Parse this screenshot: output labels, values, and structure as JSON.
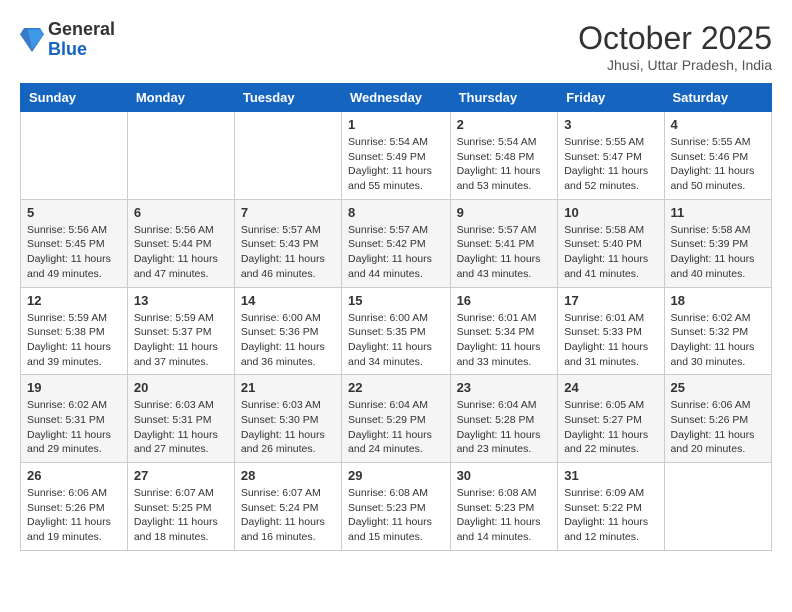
{
  "logo": {
    "general": "General",
    "blue": "Blue"
  },
  "header": {
    "month": "October 2025",
    "location": "Jhusi, Uttar Pradesh, India"
  },
  "weekdays": [
    "Sunday",
    "Monday",
    "Tuesday",
    "Wednesday",
    "Thursday",
    "Friday",
    "Saturday"
  ],
  "weeks": [
    [
      null,
      null,
      null,
      {
        "day": 1,
        "sunrise": "5:54 AM",
        "sunset": "5:49 PM",
        "daylight": "11 hours and 55 minutes."
      },
      {
        "day": 2,
        "sunrise": "5:54 AM",
        "sunset": "5:48 PM",
        "daylight": "11 hours and 53 minutes."
      },
      {
        "day": 3,
        "sunrise": "5:55 AM",
        "sunset": "5:47 PM",
        "daylight": "11 hours and 52 minutes."
      },
      {
        "day": 4,
        "sunrise": "5:55 AM",
        "sunset": "5:46 PM",
        "daylight": "11 hours and 50 minutes."
      }
    ],
    [
      {
        "day": 5,
        "sunrise": "5:56 AM",
        "sunset": "5:45 PM",
        "daylight": "11 hours and 49 minutes."
      },
      {
        "day": 6,
        "sunrise": "5:56 AM",
        "sunset": "5:44 PM",
        "daylight": "11 hours and 47 minutes."
      },
      {
        "day": 7,
        "sunrise": "5:57 AM",
        "sunset": "5:43 PM",
        "daylight": "11 hours and 46 minutes."
      },
      {
        "day": 8,
        "sunrise": "5:57 AM",
        "sunset": "5:42 PM",
        "daylight": "11 hours and 44 minutes."
      },
      {
        "day": 9,
        "sunrise": "5:57 AM",
        "sunset": "5:41 PM",
        "daylight": "11 hours and 43 minutes."
      },
      {
        "day": 10,
        "sunrise": "5:58 AM",
        "sunset": "5:40 PM",
        "daylight": "11 hours and 41 minutes."
      },
      {
        "day": 11,
        "sunrise": "5:58 AM",
        "sunset": "5:39 PM",
        "daylight": "11 hours and 40 minutes."
      }
    ],
    [
      {
        "day": 12,
        "sunrise": "5:59 AM",
        "sunset": "5:38 PM",
        "daylight": "11 hours and 39 minutes."
      },
      {
        "day": 13,
        "sunrise": "5:59 AM",
        "sunset": "5:37 PM",
        "daylight": "11 hours and 37 minutes."
      },
      {
        "day": 14,
        "sunrise": "6:00 AM",
        "sunset": "5:36 PM",
        "daylight": "11 hours and 36 minutes."
      },
      {
        "day": 15,
        "sunrise": "6:00 AM",
        "sunset": "5:35 PM",
        "daylight": "11 hours and 34 minutes."
      },
      {
        "day": 16,
        "sunrise": "6:01 AM",
        "sunset": "5:34 PM",
        "daylight": "11 hours and 33 minutes."
      },
      {
        "day": 17,
        "sunrise": "6:01 AM",
        "sunset": "5:33 PM",
        "daylight": "11 hours and 31 minutes."
      },
      {
        "day": 18,
        "sunrise": "6:02 AM",
        "sunset": "5:32 PM",
        "daylight": "11 hours and 30 minutes."
      }
    ],
    [
      {
        "day": 19,
        "sunrise": "6:02 AM",
        "sunset": "5:31 PM",
        "daylight": "11 hours and 29 minutes."
      },
      {
        "day": 20,
        "sunrise": "6:03 AM",
        "sunset": "5:31 PM",
        "daylight": "11 hours and 27 minutes."
      },
      {
        "day": 21,
        "sunrise": "6:03 AM",
        "sunset": "5:30 PM",
        "daylight": "11 hours and 26 minutes."
      },
      {
        "day": 22,
        "sunrise": "6:04 AM",
        "sunset": "5:29 PM",
        "daylight": "11 hours and 24 minutes."
      },
      {
        "day": 23,
        "sunrise": "6:04 AM",
        "sunset": "5:28 PM",
        "daylight": "11 hours and 23 minutes."
      },
      {
        "day": 24,
        "sunrise": "6:05 AM",
        "sunset": "5:27 PM",
        "daylight": "11 hours and 22 minutes."
      },
      {
        "day": 25,
        "sunrise": "6:06 AM",
        "sunset": "5:26 PM",
        "daylight": "11 hours and 20 minutes."
      }
    ],
    [
      {
        "day": 26,
        "sunrise": "6:06 AM",
        "sunset": "5:26 PM",
        "daylight": "11 hours and 19 minutes."
      },
      {
        "day": 27,
        "sunrise": "6:07 AM",
        "sunset": "5:25 PM",
        "daylight": "11 hours and 18 minutes."
      },
      {
        "day": 28,
        "sunrise": "6:07 AM",
        "sunset": "5:24 PM",
        "daylight": "11 hours and 16 minutes."
      },
      {
        "day": 29,
        "sunrise": "6:08 AM",
        "sunset": "5:23 PM",
        "daylight": "11 hours and 15 minutes."
      },
      {
        "day": 30,
        "sunrise": "6:08 AM",
        "sunset": "5:23 PM",
        "daylight": "11 hours and 14 minutes."
      },
      {
        "day": 31,
        "sunrise": "6:09 AM",
        "sunset": "5:22 PM",
        "daylight": "11 hours and 12 minutes."
      },
      null
    ]
  ],
  "labels": {
    "sunrise": "Sunrise:",
    "sunset": "Sunset:",
    "daylight": "Daylight hours"
  }
}
